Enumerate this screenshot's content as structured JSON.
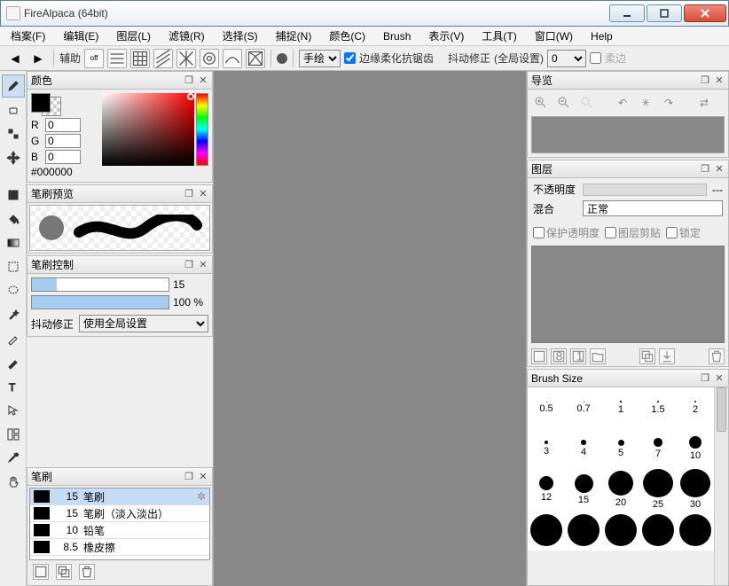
{
  "window": {
    "title": "FireAlpaca (64bit)"
  },
  "menu": [
    "档案(F)",
    "编辑(E)",
    "图层(L)",
    "滤镜(R)",
    "选择(S)",
    "捕捉(N)",
    "颜色(C)",
    "Brush",
    "表示(V)",
    "工具(T)",
    "窗口(W)",
    "Help"
  ],
  "toolbar": {
    "aux_label": "辅助",
    "mode_options": [
      "手绘"
    ],
    "mode_value": "手绘",
    "antialias": "边缘柔化抗锯齿",
    "stabilizer": "抖动修正",
    "global_setting": "(全局设置)",
    "stabilizer_value": "0",
    "soft_edge": "柔边"
  },
  "panels": {
    "color": {
      "title": "颜色",
      "r": "0",
      "g": "0",
      "b": "0",
      "hex": "#000000"
    },
    "brush_preview": {
      "title": "笔刷预览"
    },
    "brush_control": {
      "title": "笔刷控制",
      "size": "15",
      "opacity": "100 %",
      "stabilizer": "抖动修正",
      "stabilizer_option": "使用全局设置"
    },
    "brush_list": {
      "title": "笔刷",
      "items": [
        {
          "size": "15",
          "name": "笔刷",
          "selected": true
        },
        {
          "size": "15",
          "name": "笔刷（淡入淡出）"
        },
        {
          "size": "10",
          "name": "铅笔"
        },
        {
          "size": "8.5",
          "name": "橡皮擦"
        }
      ]
    },
    "navigator": {
      "title": "导览"
    },
    "layers": {
      "title": "图层",
      "opacity_label": "不透明度",
      "opacity_placeholder": "---",
      "blend_label": "混合",
      "blend_value": "正常",
      "protect_alpha": "保护透明度",
      "clipping": "图层剪贴",
      "lock": "锁定"
    },
    "brush_size": {
      "title": "Brush Size",
      "sizes": [
        "0.5",
        "0.7",
        "1",
        "1.5",
        "2",
        "3",
        "4",
        "5",
        "7",
        "10",
        "12",
        "15",
        "20",
        "25",
        "30"
      ]
    }
  },
  "rgb_labels": {
    "r": "R",
    "g": "G",
    "b": "B"
  }
}
